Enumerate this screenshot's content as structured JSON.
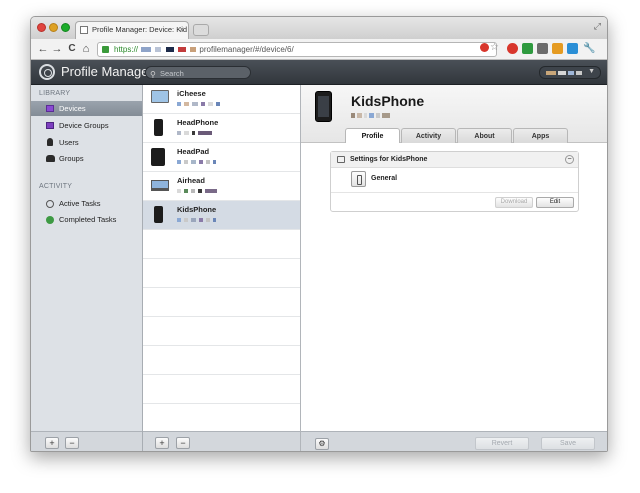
{
  "browser": {
    "tab_title": "Profile Manager: Device: Kid",
    "tab_close": "×",
    "url_protocol": "https://",
    "url_path": "profilemanager/#/device/6/",
    "back": "←",
    "forward": "→",
    "reload": "C",
    "home": "⌂",
    "fullscreen": "⤢",
    "star": "☆",
    "wrench": "🔧"
  },
  "app": {
    "title": "Profile Manager",
    "search_placeholder": "Search"
  },
  "sidebar": {
    "library_heading": "LIBRARY",
    "activity_heading": "ACTIVITY",
    "items": [
      {
        "label": "Devices",
        "icon": "devices-icon",
        "selected": true
      },
      {
        "label": "Device Groups",
        "icon": "device-groups-icon",
        "selected": false
      },
      {
        "label": "Users",
        "icon": "user-icon",
        "selected": false
      },
      {
        "label": "Groups",
        "icon": "groups-icon",
        "selected": false
      }
    ],
    "activity_items": [
      {
        "label": "Active Tasks",
        "icon": "active-tasks-icon"
      },
      {
        "label": "Completed Tasks",
        "icon": "completed-tasks-icon"
      }
    ],
    "add": "+",
    "remove": "−"
  },
  "devices": [
    {
      "name": "iCheese",
      "type": "imac",
      "selected": false
    },
    {
      "name": "HeadPhone",
      "type": "iphone",
      "selected": false
    },
    {
      "name": "HeadPad",
      "type": "ipad",
      "selected": false
    },
    {
      "name": "Airhead",
      "type": "macbook",
      "selected": false
    },
    {
      "name": "KidsPhone",
      "type": "iphone",
      "selected": true
    }
  ],
  "devlist_footer": {
    "add": "+",
    "remove": "−"
  },
  "detail": {
    "device_name": "KidsPhone",
    "tabs": [
      "Profile",
      "Activity",
      "About",
      "Apps"
    ],
    "active_tab": "Profile",
    "settings_title": "Settings for KidsPhone",
    "collapse": "−",
    "payload": "General",
    "download": "Download",
    "edit": "Edit",
    "gear": "⚙",
    "revert": "Revert",
    "save": "Save"
  },
  "colors": {
    "appbar": "#3b4046",
    "sidebar": "#dde1e6",
    "selection": "#8d96a0",
    "list_selection": "#d4dbe4"
  }
}
